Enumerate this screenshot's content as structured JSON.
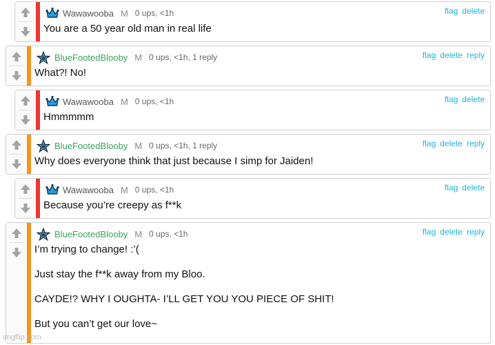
{
  "colors": {
    "red_bar": "#ee3530",
    "orange_bar": "#f7941e",
    "link": "#1bb4d8",
    "username_green": "#3aa35a"
  },
  "comments": [
    {
      "user": "Wawawooba",
      "gender": "M",
      "stats": "0 ups, <1h",
      "actions": [
        "flag",
        "delete"
      ],
      "text": [
        "You are a 50 year old man in real life"
      ],
      "avatar_icon": "blue-crown-icon",
      "bar_color": "red"
    },
    {
      "user": "BlueFootedBlooby",
      "gender": "M",
      "stats": "0 ups, <1h, 1 reply",
      "actions": [
        "flag",
        "delete",
        "reply"
      ],
      "text": [
        "What?! No!"
      ],
      "avatar_icon": "navy-star-icon",
      "bar_color": "orange"
    },
    {
      "user": "Wawawooba",
      "gender": "M",
      "stats": "0 ups, <1h",
      "actions": [
        "flag",
        "delete"
      ],
      "text": [
        "Hmmmmm"
      ],
      "avatar_icon": "blue-crown-icon",
      "bar_color": "red"
    },
    {
      "user": "BlueFootedBlooby",
      "gender": "M",
      "stats": "0 ups, <1h, 1 reply",
      "actions": [
        "flag",
        "delete",
        "reply"
      ],
      "text": [
        "Why does everyone think that just because I simp for Jaiden!"
      ],
      "avatar_icon": "navy-star-icon",
      "bar_color": "orange"
    },
    {
      "user": "Wawawooba",
      "gender": "M",
      "stats": "0 ups, <1h",
      "actions": [
        "flag",
        "delete"
      ],
      "text": [
        "Because you’re creepy as f**k"
      ],
      "avatar_icon": "blue-crown-icon",
      "bar_color": "red"
    },
    {
      "user": "BlueFootedBlooby",
      "gender": "M",
      "stats": "0 ups, <1h",
      "actions": [
        "flag",
        "delete",
        "reply"
      ],
      "text": [
        "I’m trying to change! :’(",
        "Just stay the f**k away from my Bloo.",
        "CAYDE!? WHY I OUGHTA- I’LL GET YOU YOU PIECE OF SHIT!",
        "But you can’t get our love~"
      ],
      "avatar_icon": "navy-star-icon",
      "bar_color": "orange"
    }
  ],
  "watermark": "imgflip.com"
}
